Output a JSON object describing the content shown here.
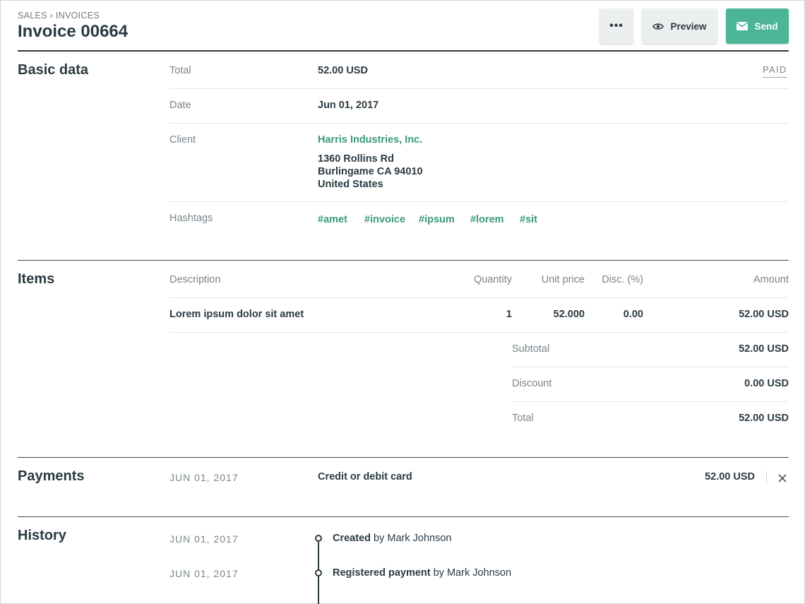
{
  "header": {
    "breadcrumb_parent": "SALES",
    "breadcrumb_sep": "›",
    "breadcrumb_current": "INVOICES",
    "title": "Invoice 00664",
    "more_label": "•••",
    "preview_label": "Preview",
    "send_label": "Send"
  },
  "basic_data": {
    "title": "Basic data",
    "status": "PAID",
    "total_label": "Total",
    "total_value": "52.00 USD",
    "date_label": "Date",
    "date_value": "Jun 01, 2017",
    "client_label": "Client",
    "client_name": "Harris Industries, Inc.",
    "address_line1": "1360 Rollins Rd",
    "address_line2": "Burlingame CA 94010",
    "address_line3": "United States",
    "hashtags_label": "Hashtags",
    "hashtags": [
      "#amet",
      "#invoice",
      "#ipsum",
      "#lorem",
      "#sit"
    ]
  },
  "items": {
    "title": "Items",
    "columns": {
      "description": "Description",
      "quantity": "Quantity",
      "unit_price": "Unit price",
      "discount": "Disc. (%)",
      "amount": "Amount"
    },
    "rows": [
      {
        "description": "Lorem ipsum dolor sit amet",
        "quantity": "1",
        "unit_price": "52.000",
        "discount": "0.00",
        "amount": "52.00 USD"
      }
    ],
    "subtotal_label": "Subtotal",
    "subtotal_value": "52.00 USD",
    "discount_label": "Discount",
    "discount_value": "0.00 USD",
    "total_label": "Total",
    "total_value": "52.00 USD"
  },
  "payments": {
    "title": "Payments",
    "rows": [
      {
        "date": "JUN 01, 2017",
        "method": "Credit or debit card",
        "amount": "52.00 USD"
      }
    ]
  },
  "history": {
    "title": "History",
    "entries": [
      {
        "date": "JUN 01, 2017",
        "action": "Created",
        "by": "by Mark Johnson"
      },
      {
        "date": "JUN 01, 2017",
        "action": "Registered payment",
        "by": "by Mark Johnson"
      }
    ]
  },
  "colors": {
    "accent": "#4cb597",
    "link": "#3a9a7c",
    "text": "#2b3a42",
    "muted": "#7a858b",
    "button_bg": "#eceff0"
  },
  "icons": {
    "more": "more-dots-icon",
    "preview": "eye-icon",
    "send": "envelope-icon",
    "remove_payment": "close-icon"
  }
}
